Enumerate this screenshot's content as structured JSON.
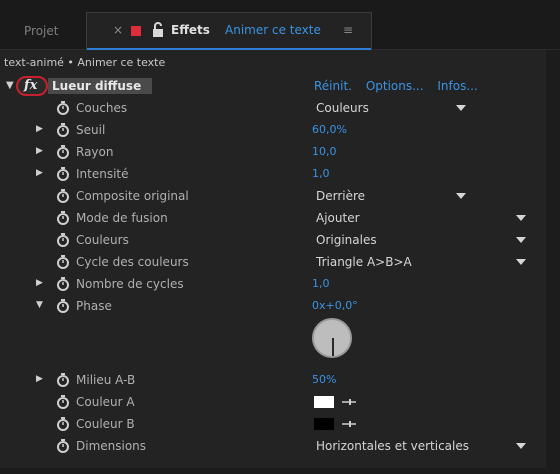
{
  "tabs": {
    "project_label": "Projet",
    "close_glyph": "×",
    "effects_label": "Effets",
    "layer_name": "Animer ce texte",
    "menu_glyph": "≡",
    "label_color": "#e02d3b",
    "accent": "#3a93e2"
  },
  "breadcrumb": "text-animé • Animer ce texte",
  "effect": {
    "fx_glyph": "fx",
    "name": "Lueur diffuse",
    "reset": "Réinit.",
    "options": "Options...",
    "about": "Infos..."
  },
  "properties": [
    {
      "label": "Couches",
      "value": "Couleurs",
      "kind": "dropdown-short"
    },
    {
      "label": "Seuil",
      "value": "60,0%",
      "kind": "number"
    },
    {
      "label": "Rayon",
      "value": "10,0",
      "kind": "number"
    },
    {
      "label": "Intensité",
      "value": "1,0",
      "kind": "number"
    },
    {
      "label": "Composite original",
      "value": "Derrière",
      "kind": "dropdown-short"
    },
    {
      "label": "Mode de fusion",
      "value": "Ajouter",
      "kind": "dropdown"
    },
    {
      "label": "Couleurs",
      "value": "Originales",
      "kind": "dropdown"
    },
    {
      "label": "Cycle des couleurs",
      "value": "Triangle A>B>A",
      "kind": "dropdown"
    },
    {
      "label": "Nombre de cycles",
      "value": "1,0",
      "kind": "number"
    },
    {
      "label": "Phase",
      "value": "0x+0,0°",
      "kind": "angle"
    },
    {
      "label": "Milieu A-B",
      "value": "50%",
      "kind": "number"
    },
    {
      "label": "Couleur A",
      "value": "#ffffff",
      "kind": "color"
    },
    {
      "label": "Couleur B",
      "value": "#000000",
      "kind": "color"
    },
    {
      "label": "Dimensions",
      "value": "Horizontales et verticales",
      "kind": "dropdown"
    }
  ]
}
